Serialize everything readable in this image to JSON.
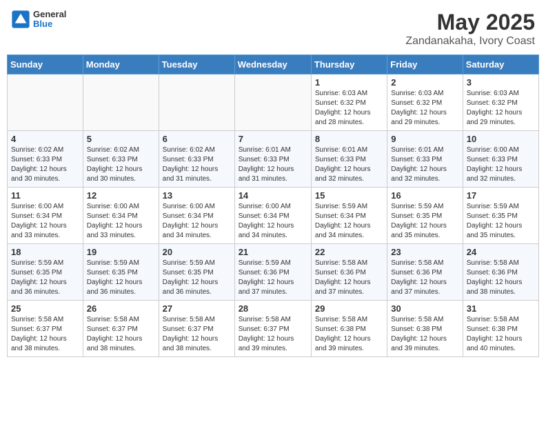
{
  "header": {
    "logo_general": "General",
    "logo_blue": "Blue",
    "title": "May 2025",
    "subtitle": "Zandanakaha, Ivory Coast"
  },
  "weekdays": [
    "Sunday",
    "Monday",
    "Tuesday",
    "Wednesday",
    "Thursday",
    "Friday",
    "Saturday"
  ],
  "weeks": [
    [
      {
        "day": "",
        "info": ""
      },
      {
        "day": "",
        "info": ""
      },
      {
        "day": "",
        "info": ""
      },
      {
        "day": "",
        "info": ""
      },
      {
        "day": "1",
        "info": "Sunrise: 6:03 AM\nSunset: 6:32 PM\nDaylight: 12 hours\nand 28 minutes."
      },
      {
        "day": "2",
        "info": "Sunrise: 6:03 AM\nSunset: 6:32 PM\nDaylight: 12 hours\nand 29 minutes."
      },
      {
        "day": "3",
        "info": "Sunrise: 6:03 AM\nSunset: 6:32 PM\nDaylight: 12 hours\nand 29 minutes."
      }
    ],
    [
      {
        "day": "4",
        "info": "Sunrise: 6:02 AM\nSunset: 6:33 PM\nDaylight: 12 hours\nand 30 minutes."
      },
      {
        "day": "5",
        "info": "Sunrise: 6:02 AM\nSunset: 6:33 PM\nDaylight: 12 hours\nand 30 minutes."
      },
      {
        "day": "6",
        "info": "Sunrise: 6:02 AM\nSunset: 6:33 PM\nDaylight: 12 hours\nand 31 minutes."
      },
      {
        "day": "7",
        "info": "Sunrise: 6:01 AM\nSunset: 6:33 PM\nDaylight: 12 hours\nand 31 minutes."
      },
      {
        "day": "8",
        "info": "Sunrise: 6:01 AM\nSunset: 6:33 PM\nDaylight: 12 hours\nand 32 minutes."
      },
      {
        "day": "9",
        "info": "Sunrise: 6:01 AM\nSunset: 6:33 PM\nDaylight: 12 hours\nand 32 minutes."
      },
      {
        "day": "10",
        "info": "Sunrise: 6:00 AM\nSunset: 6:33 PM\nDaylight: 12 hours\nand 32 minutes."
      }
    ],
    [
      {
        "day": "11",
        "info": "Sunrise: 6:00 AM\nSunset: 6:34 PM\nDaylight: 12 hours\nand 33 minutes."
      },
      {
        "day": "12",
        "info": "Sunrise: 6:00 AM\nSunset: 6:34 PM\nDaylight: 12 hours\nand 33 minutes."
      },
      {
        "day": "13",
        "info": "Sunrise: 6:00 AM\nSunset: 6:34 PM\nDaylight: 12 hours\nand 34 minutes."
      },
      {
        "day": "14",
        "info": "Sunrise: 6:00 AM\nSunset: 6:34 PM\nDaylight: 12 hours\nand 34 minutes."
      },
      {
        "day": "15",
        "info": "Sunrise: 5:59 AM\nSunset: 6:34 PM\nDaylight: 12 hours\nand 34 minutes."
      },
      {
        "day": "16",
        "info": "Sunrise: 5:59 AM\nSunset: 6:35 PM\nDaylight: 12 hours\nand 35 minutes."
      },
      {
        "day": "17",
        "info": "Sunrise: 5:59 AM\nSunset: 6:35 PM\nDaylight: 12 hours\nand 35 minutes."
      }
    ],
    [
      {
        "day": "18",
        "info": "Sunrise: 5:59 AM\nSunset: 6:35 PM\nDaylight: 12 hours\nand 36 minutes."
      },
      {
        "day": "19",
        "info": "Sunrise: 5:59 AM\nSunset: 6:35 PM\nDaylight: 12 hours\nand 36 minutes."
      },
      {
        "day": "20",
        "info": "Sunrise: 5:59 AM\nSunset: 6:35 PM\nDaylight: 12 hours\nand 36 minutes."
      },
      {
        "day": "21",
        "info": "Sunrise: 5:59 AM\nSunset: 6:36 PM\nDaylight: 12 hours\nand 37 minutes."
      },
      {
        "day": "22",
        "info": "Sunrise: 5:58 AM\nSunset: 6:36 PM\nDaylight: 12 hours\nand 37 minutes."
      },
      {
        "day": "23",
        "info": "Sunrise: 5:58 AM\nSunset: 6:36 PM\nDaylight: 12 hours\nand 37 minutes."
      },
      {
        "day": "24",
        "info": "Sunrise: 5:58 AM\nSunset: 6:36 PM\nDaylight: 12 hours\nand 38 minutes."
      }
    ],
    [
      {
        "day": "25",
        "info": "Sunrise: 5:58 AM\nSunset: 6:37 PM\nDaylight: 12 hours\nand 38 minutes."
      },
      {
        "day": "26",
        "info": "Sunrise: 5:58 AM\nSunset: 6:37 PM\nDaylight: 12 hours\nand 38 minutes."
      },
      {
        "day": "27",
        "info": "Sunrise: 5:58 AM\nSunset: 6:37 PM\nDaylight: 12 hours\nand 38 minutes."
      },
      {
        "day": "28",
        "info": "Sunrise: 5:58 AM\nSunset: 6:37 PM\nDaylight: 12 hours\nand 39 minutes."
      },
      {
        "day": "29",
        "info": "Sunrise: 5:58 AM\nSunset: 6:38 PM\nDaylight: 12 hours\nand 39 minutes."
      },
      {
        "day": "30",
        "info": "Sunrise: 5:58 AM\nSunset: 6:38 PM\nDaylight: 12 hours\nand 39 minutes."
      },
      {
        "day": "31",
        "info": "Sunrise: 5:58 AM\nSunset: 6:38 PM\nDaylight: 12 hours\nand 40 minutes."
      }
    ]
  ]
}
